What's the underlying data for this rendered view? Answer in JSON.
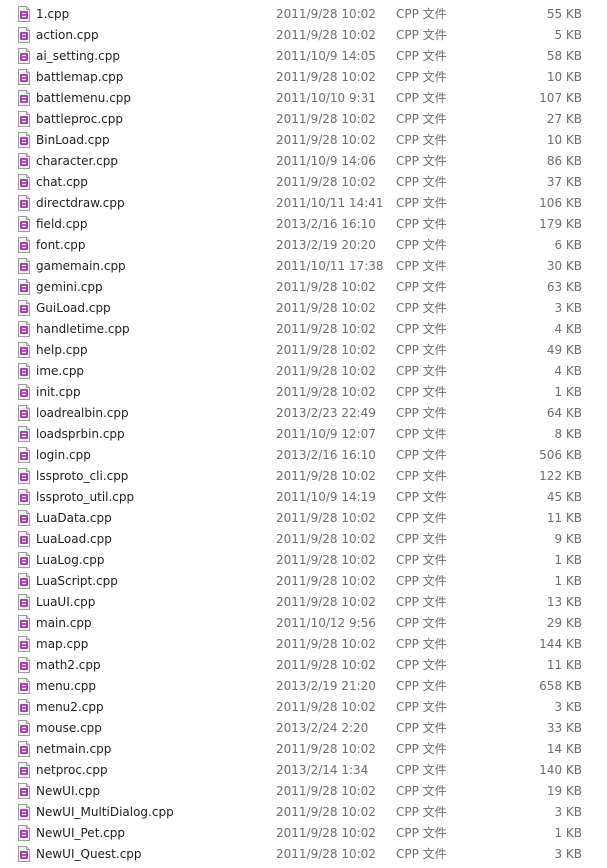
{
  "files": [
    {
      "name": "1.cpp",
      "date": "2011/9/28 10:02",
      "type": "CPP 文件",
      "size": "55 KB"
    },
    {
      "name": "action.cpp",
      "date": "2011/9/28 10:02",
      "type": "CPP 文件",
      "size": "5 KB"
    },
    {
      "name": "ai_setting.cpp",
      "date": "2011/10/9 14:05",
      "type": "CPP 文件",
      "size": "58 KB"
    },
    {
      "name": "battlemap.cpp",
      "date": "2011/9/28 10:02",
      "type": "CPP 文件",
      "size": "10 KB"
    },
    {
      "name": "battlemenu.cpp",
      "date": "2011/10/10 9:31",
      "type": "CPP 文件",
      "size": "107 KB"
    },
    {
      "name": "battleproc.cpp",
      "date": "2011/9/28 10:02",
      "type": "CPP 文件",
      "size": "27 KB"
    },
    {
      "name": "BinLoad.cpp",
      "date": "2011/9/28 10:02",
      "type": "CPP 文件",
      "size": "10 KB"
    },
    {
      "name": "character.cpp",
      "date": "2011/10/9 14:06",
      "type": "CPP 文件",
      "size": "86 KB"
    },
    {
      "name": "chat.cpp",
      "date": "2011/9/28 10:02",
      "type": "CPP 文件",
      "size": "37 KB"
    },
    {
      "name": "directdraw.cpp",
      "date": "2011/10/11 14:41",
      "type": "CPP 文件",
      "size": "106 KB"
    },
    {
      "name": "field.cpp",
      "date": "2013/2/16 16:10",
      "type": "CPP 文件",
      "size": "179 KB"
    },
    {
      "name": "font.cpp",
      "date": "2013/2/19 20:20",
      "type": "CPP 文件",
      "size": "6 KB"
    },
    {
      "name": "gamemain.cpp",
      "date": "2011/10/11 17:38",
      "type": "CPP 文件",
      "size": "30 KB"
    },
    {
      "name": "gemini.cpp",
      "date": "2011/9/28 10:02",
      "type": "CPP 文件",
      "size": "63 KB"
    },
    {
      "name": "GuiLoad.cpp",
      "date": "2011/9/28 10:02",
      "type": "CPP 文件",
      "size": "3 KB"
    },
    {
      "name": "handletime.cpp",
      "date": "2011/9/28 10:02",
      "type": "CPP 文件",
      "size": "4 KB"
    },
    {
      "name": "help.cpp",
      "date": "2011/9/28 10:02",
      "type": "CPP 文件",
      "size": "49 KB"
    },
    {
      "name": "ime.cpp",
      "date": "2011/9/28 10:02",
      "type": "CPP 文件",
      "size": "4 KB"
    },
    {
      "name": "init.cpp",
      "date": "2011/9/28 10:02",
      "type": "CPP 文件",
      "size": "1 KB"
    },
    {
      "name": "loadrealbin.cpp",
      "date": "2013/2/23 22:49",
      "type": "CPP 文件",
      "size": "64 KB"
    },
    {
      "name": "loadsprbin.cpp",
      "date": "2011/10/9 12:07",
      "type": "CPP 文件",
      "size": "8 KB"
    },
    {
      "name": "login.cpp",
      "date": "2013/2/16 16:10",
      "type": "CPP 文件",
      "size": "506 KB"
    },
    {
      "name": "lssproto_cli.cpp",
      "date": "2011/9/28 10:02",
      "type": "CPP 文件",
      "size": "122 KB"
    },
    {
      "name": "lssproto_util.cpp",
      "date": "2011/10/9 14:19",
      "type": "CPP 文件",
      "size": "45 KB"
    },
    {
      "name": "LuaData.cpp",
      "date": "2011/9/28 10:02",
      "type": "CPP 文件",
      "size": "11 KB"
    },
    {
      "name": "LuaLoad.cpp",
      "date": "2011/9/28 10:02",
      "type": "CPP 文件",
      "size": "9 KB"
    },
    {
      "name": "LuaLog.cpp",
      "date": "2011/9/28 10:02",
      "type": "CPP 文件",
      "size": "1 KB"
    },
    {
      "name": "LuaScript.cpp",
      "date": "2011/9/28 10:02",
      "type": "CPP 文件",
      "size": "1 KB"
    },
    {
      "name": "LuaUI.cpp",
      "date": "2011/9/28 10:02",
      "type": "CPP 文件",
      "size": "13 KB"
    },
    {
      "name": "main.cpp",
      "date": "2011/10/12 9:56",
      "type": "CPP 文件",
      "size": "29 KB"
    },
    {
      "name": "map.cpp",
      "date": "2011/9/28 10:02",
      "type": "CPP 文件",
      "size": "144 KB"
    },
    {
      "name": "math2.cpp",
      "date": "2011/9/28 10:02",
      "type": "CPP 文件",
      "size": "11 KB"
    },
    {
      "name": "menu.cpp",
      "date": "2013/2/19 21:20",
      "type": "CPP 文件",
      "size": "658 KB"
    },
    {
      "name": "menu2.cpp",
      "date": "2011/9/28 10:02",
      "type": "CPP 文件",
      "size": "3 KB"
    },
    {
      "name": "mouse.cpp",
      "date": "2013/2/24 2:20",
      "type": "CPP 文件",
      "size": "33 KB"
    },
    {
      "name": "netmain.cpp",
      "date": "2011/9/28 10:02",
      "type": "CPP 文件",
      "size": "14 KB"
    },
    {
      "name": "netproc.cpp",
      "date": "2013/2/14 1:34",
      "type": "CPP 文件",
      "size": "140 KB"
    },
    {
      "name": "NewUI.cpp",
      "date": "2011/9/28 10:02",
      "type": "CPP 文件",
      "size": "19 KB"
    },
    {
      "name": "NewUI_MultiDialog.cpp",
      "date": "2011/9/28 10:02",
      "type": "CPP 文件",
      "size": "3 KB"
    },
    {
      "name": "NewUI_Pet.cpp",
      "date": "2011/9/28 10:02",
      "type": "CPP 文件",
      "size": "1 KB"
    },
    {
      "name": "NewUI_Quest.cpp",
      "date": "2011/9/28 10:02",
      "type": "CPP 文件",
      "size": "3 KB"
    }
  ],
  "icon": "cpp-file-icon",
  "colors": {
    "text": "#1e1e1e",
    "secondary_text": "#6d6d6d",
    "icon_body": "#a63bb5",
    "icon_page": "#f2f2f2"
  }
}
